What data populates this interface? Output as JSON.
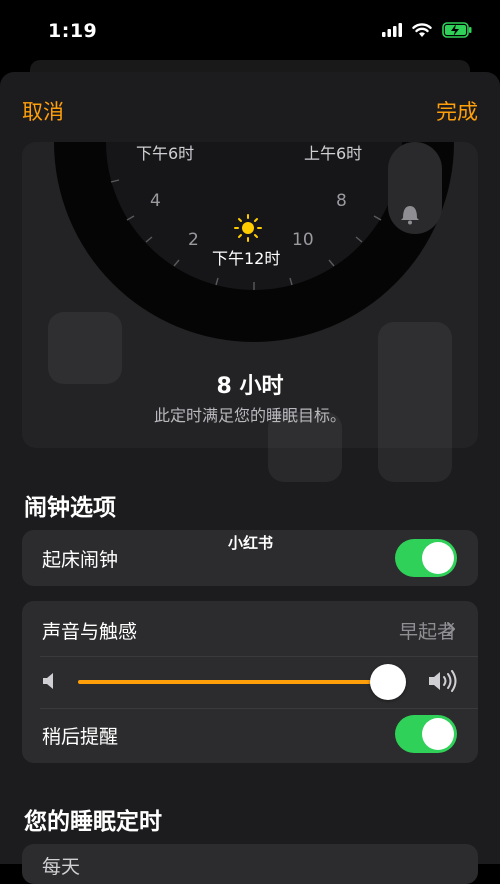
{
  "status_bar": {
    "time": "1:19"
  },
  "nav": {
    "cancel": "取消",
    "done": "完成"
  },
  "clock": {
    "label_top_left": "下午6时",
    "label_top_right": "上午6时",
    "label_bottom": "下午12时",
    "tick_left_4": "4",
    "tick_left_2": "2",
    "tick_right_8": "8",
    "tick_right_10": "10"
  },
  "duration": {
    "title": "8 小时",
    "subtitle": "此定时满足您的睡眠目标。"
  },
  "alarm_section": {
    "title": "闹钟选项",
    "wake_alarm_label": "起床闹钟",
    "wake_alarm_on": true,
    "sound_label": "声音与触感",
    "sound_value": "早起者",
    "volume_level": 0.97,
    "snooze_label": "稍后提醒",
    "snooze_on": true
  },
  "schedule_section": {
    "title": "您的睡眠定时",
    "next_label": "每天"
  },
  "watermark": "小红书",
  "colors": {
    "accent": "#ff9f0a",
    "toggle_on": "#30d158",
    "background": "#000000"
  }
}
